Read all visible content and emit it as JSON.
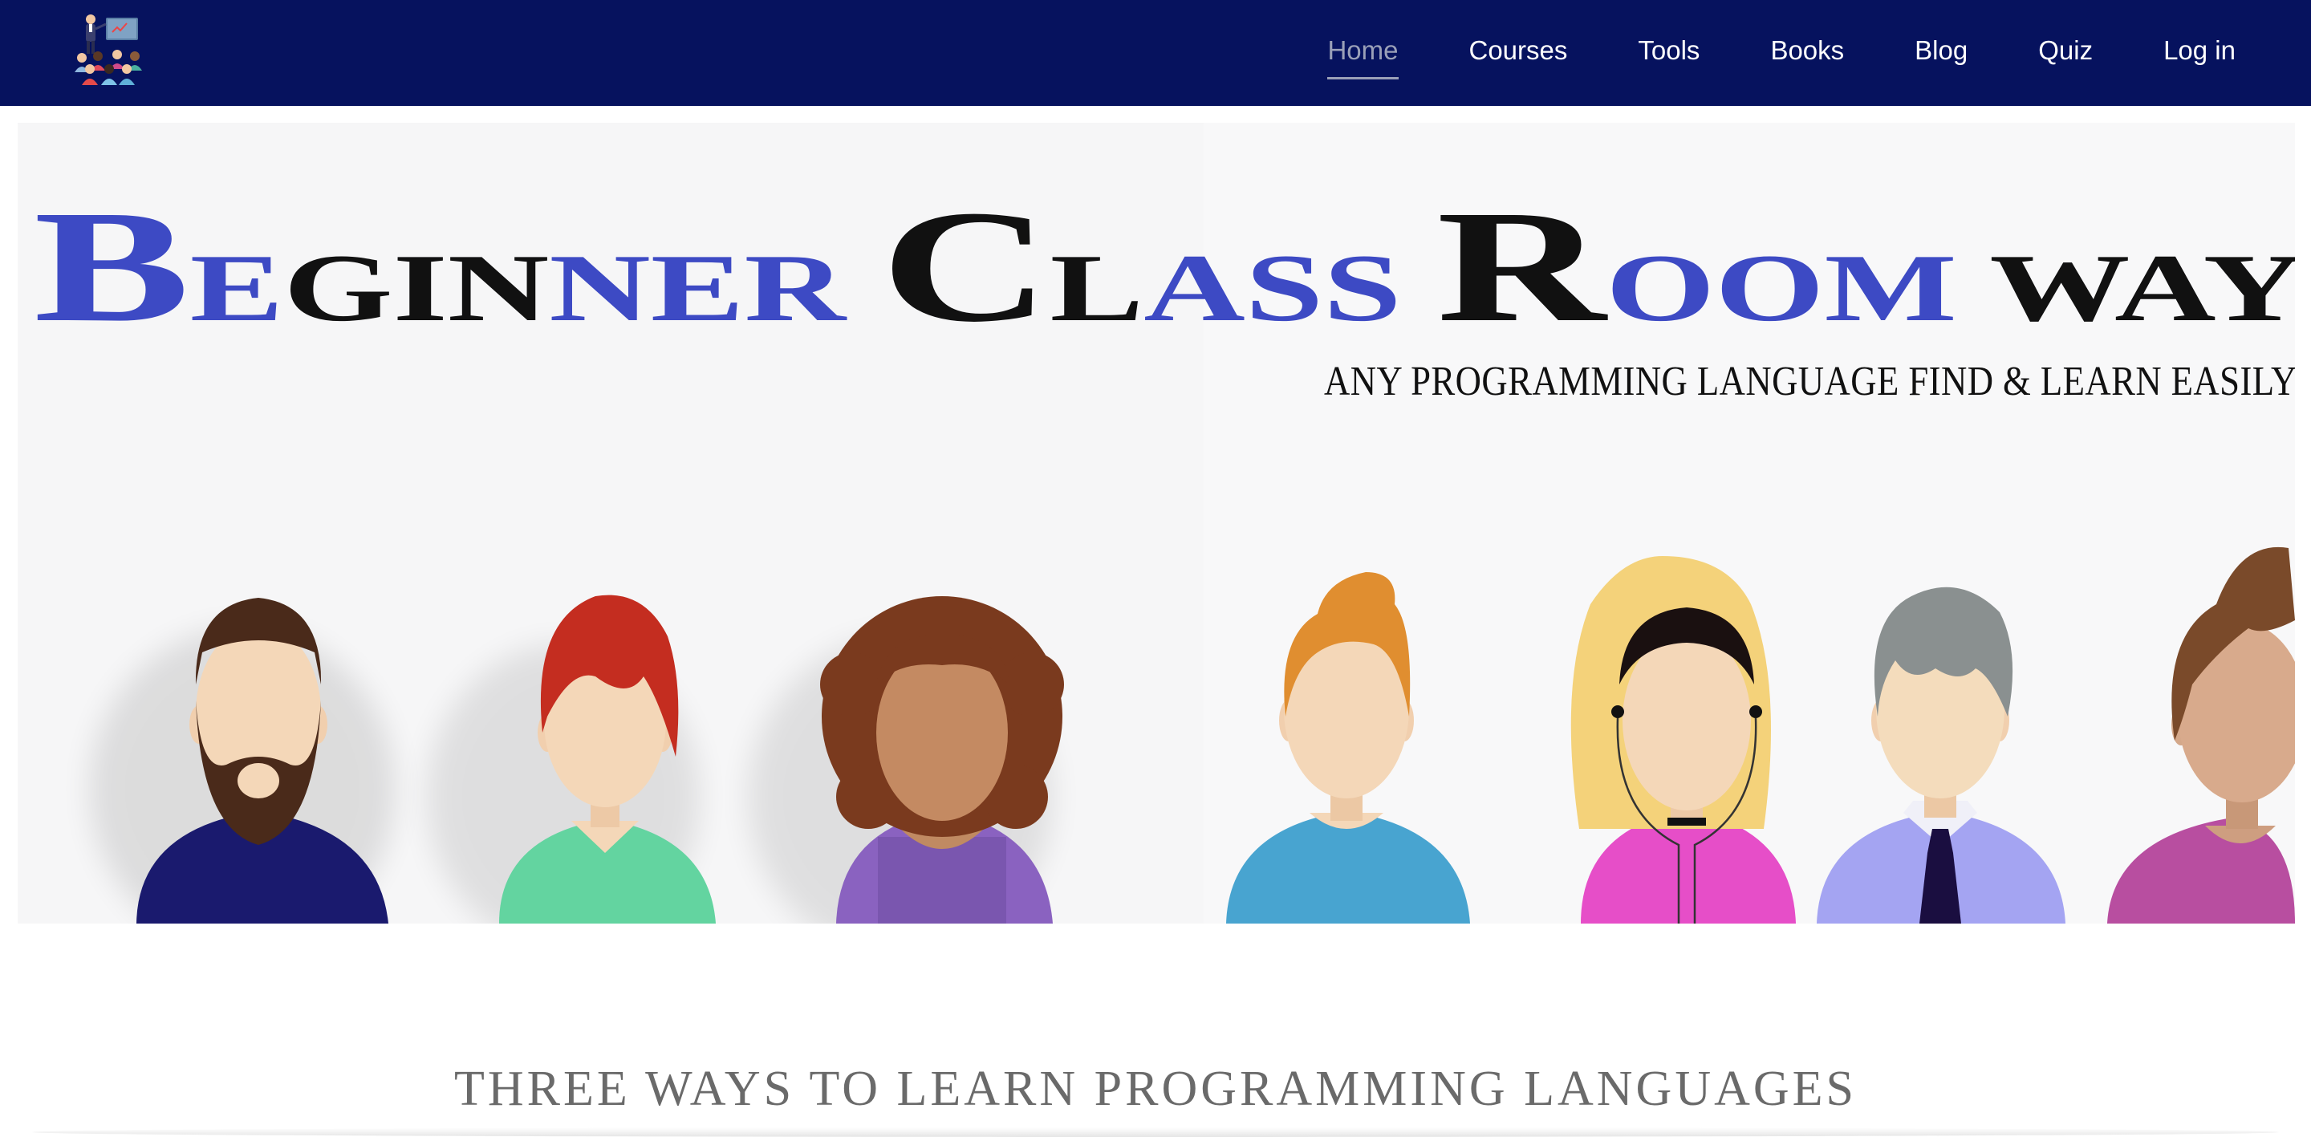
{
  "header": {
    "logo_icon": "teacher-classroom-icon",
    "colors": {
      "background": "#06125e",
      "link": "#ffffff",
      "active_link": "#9aa0b8"
    },
    "nav": [
      {
        "label": "Home",
        "active": true
      },
      {
        "label": "Courses",
        "active": false
      },
      {
        "label": "Tools",
        "active": false
      },
      {
        "label": "Books",
        "active": false
      },
      {
        "label": "Blog",
        "active": false
      },
      {
        "label": "Quiz",
        "active": false
      },
      {
        "label": "Log in",
        "active": false
      }
    ]
  },
  "hero": {
    "title_words": [
      {
        "initial": "B",
        "rest": "EGINNER",
        "initial_color": "#3d4ac4",
        "rest_colors": [
          "#3d4ac4",
          "#111111",
          "#111111",
          "#111111",
          "#3d4ac4",
          "#3d4ac4",
          "#3d4ac4"
        ]
      },
      {
        "initial": "C",
        "rest": "LASS",
        "initial_color": "#111111",
        "rest_colors": [
          "#111111",
          "#3d4ac4",
          "#3d4ac4",
          "#3d4ac4"
        ]
      },
      {
        "initial": "R",
        "rest": "OOM",
        "initial_color": "#111111",
        "rest_colors": [
          "#3d4ac4",
          "#3d4ac4",
          "#3d4ac4"
        ]
      },
      {
        "initial": "",
        "rest": "WAY",
        "initial_color": "#111111",
        "rest_colors": [
          "#111111",
          "#111111",
          "#111111"
        ]
      }
    ],
    "tagline": "ANY PROGRAMMING LANGUAGE FIND &  LEARN  EASILY",
    "avatar_icons": [
      "bearded-man-avatar-icon",
      "red-hair-woman-avatar-icon",
      "curly-hair-woman-avatar-icon",
      "orange-hair-man-avatar-icon",
      "blonde-woman-headphones-avatar-icon",
      "gray-hair-man-tie-avatar-icon",
      "brown-hair-woman-avatar-icon"
    ]
  },
  "section": {
    "title": "THREE WAYS TO LEARN PROGRAMMING LANGUAGES"
  }
}
